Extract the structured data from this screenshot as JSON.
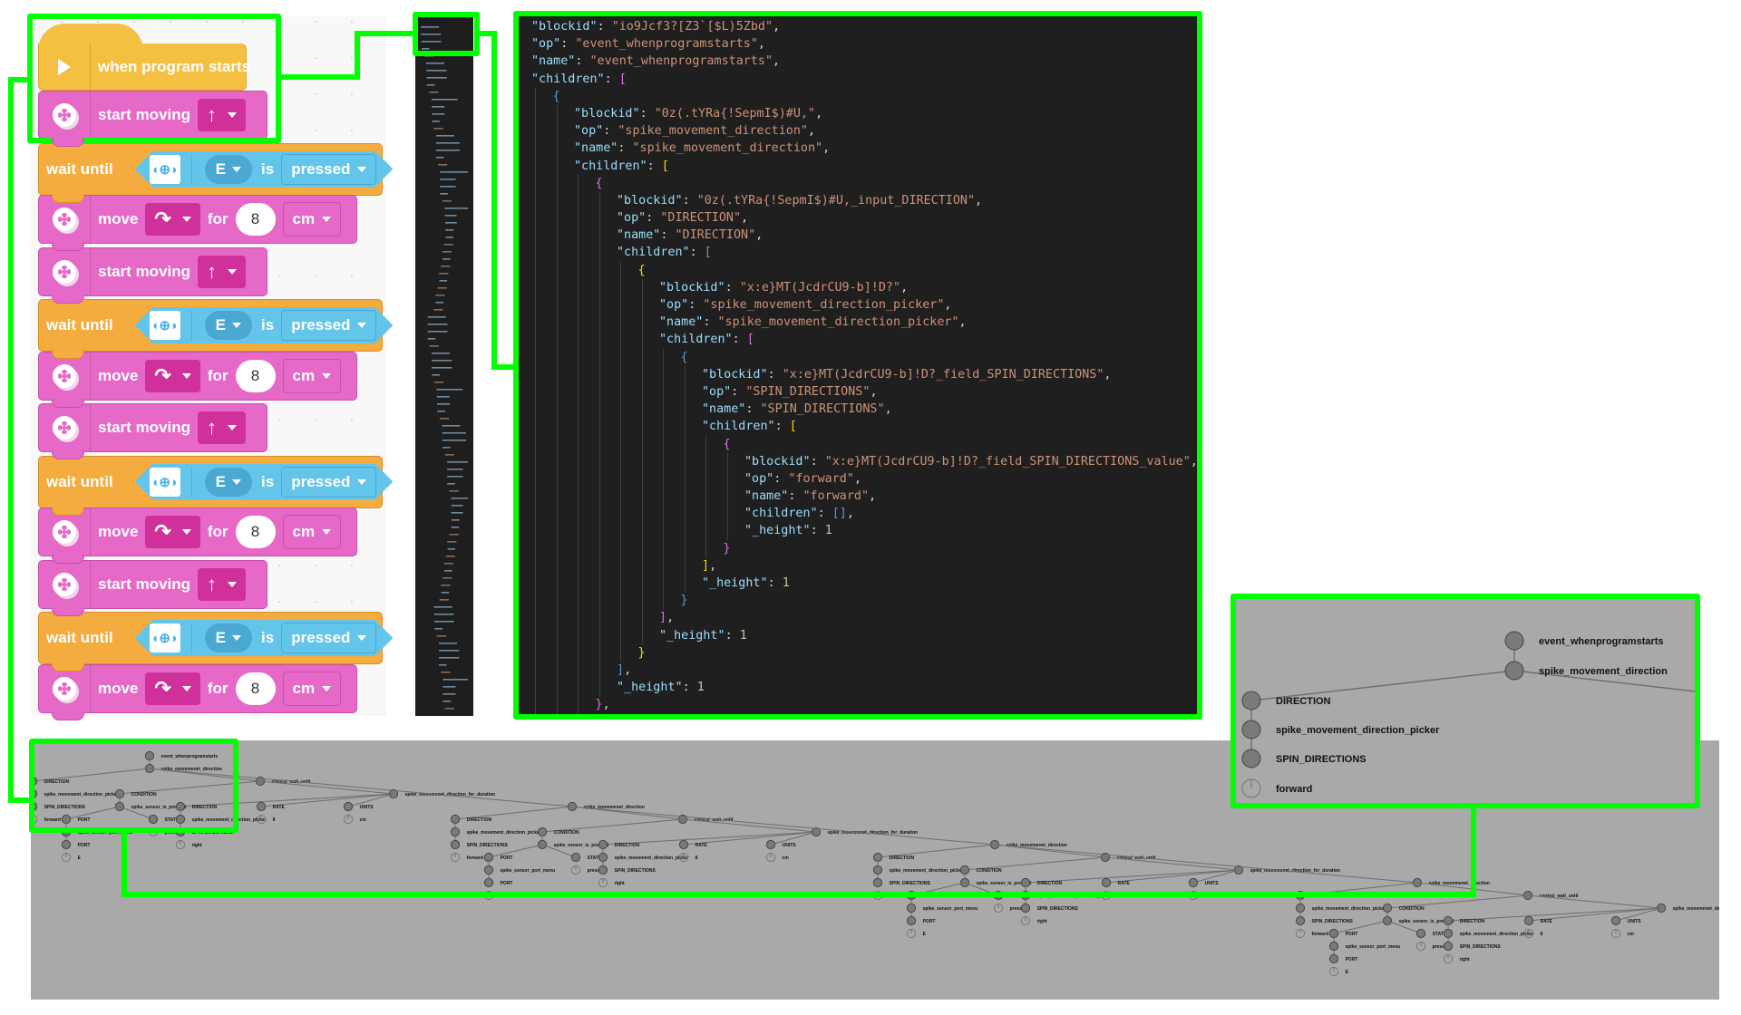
{
  "blocks_program": {
    "hat": {
      "label": "when program starts",
      "icon": "play-icon"
    },
    "blocks": [
      {
        "type": "start_moving",
        "label": "start moving",
        "direction_glyph": "↑",
        "direction": "forward"
      },
      {
        "type": "wait_until",
        "label": "wait until",
        "sensor_icon": "force-sensor-icon",
        "port": "E",
        "is_label": "is",
        "state": "pressed"
      },
      {
        "type": "move_for",
        "label": "move",
        "direction_glyph": "↷",
        "direction": "right",
        "for_label": "for",
        "amount": "8",
        "unit": "cm"
      },
      {
        "type": "start_moving",
        "label": "start moving",
        "direction_glyph": "↑",
        "direction": "forward"
      },
      {
        "type": "wait_until",
        "label": "wait until",
        "sensor_icon": "force-sensor-icon",
        "port": "E",
        "is_label": "is",
        "state": "pressed"
      },
      {
        "type": "move_for",
        "label": "move",
        "direction_glyph": "↷",
        "direction": "right",
        "for_label": "for",
        "amount": "8",
        "unit": "cm"
      },
      {
        "type": "start_moving",
        "label": "start moving",
        "direction_glyph": "↑",
        "direction": "forward"
      },
      {
        "type": "wait_until",
        "label": "wait until",
        "sensor_icon": "force-sensor-icon",
        "port": "E",
        "is_label": "is",
        "state": "pressed"
      },
      {
        "type": "move_for",
        "label": "move",
        "direction_glyph": "↷",
        "direction": "right",
        "for_label": "for",
        "amount": "8",
        "unit": "cm"
      },
      {
        "type": "start_moving",
        "label": "start moving",
        "direction_glyph": "↑",
        "direction": "forward"
      },
      {
        "type": "wait_until",
        "label": "wait until",
        "sensor_icon": "force-sensor-icon",
        "port": "E",
        "is_label": "is",
        "state": "pressed"
      },
      {
        "type": "move_for",
        "label": "move",
        "direction_glyph": "↷",
        "direction": "right",
        "for_label": "for",
        "amount": "8",
        "unit": "cm"
      }
    ]
  },
  "json_view": {
    "lines": [
      {
        "indent": 0,
        "parts": [
          [
            "k",
            "\"blockid\""
          ],
          [
            "p",
            ": "
          ],
          [
            "s",
            "\"io9Jcf3?[Z3`[$L)5Zbd\""
          ],
          [
            "p",
            ","
          ]
        ]
      },
      {
        "indent": 0,
        "parts": [
          [
            "k",
            "\"op\""
          ],
          [
            "p",
            ": "
          ],
          [
            "s",
            "\"event_whenprogramstarts\""
          ],
          [
            "p",
            ","
          ]
        ]
      },
      {
        "indent": 0,
        "parts": [
          [
            "k",
            "\"name\""
          ],
          [
            "p",
            ": "
          ],
          [
            "s",
            "\"event_whenprogramstarts\""
          ],
          [
            "p",
            ","
          ]
        ]
      },
      {
        "indent": 0,
        "parts": [
          [
            "k",
            "\"children\""
          ],
          [
            "p",
            ": "
          ],
          [
            "b1",
            "["
          ]
        ]
      },
      {
        "indent": 1,
        "parts": [
          [
            "b3",
            "{"
          ]
        ]
      },
      {
        "indent": 2,
        "parts": [
          [
            "k",
            "\"blockid\""
          ],
          [
            "p",
            ": "
          ],
          [
            "s",
            "\"0z(.tYRa{!SepmI$)#U,\""
          ],
          [
            "p",
            ","
          ]
        ]
      },
      {
        "indent": 2,
        "parts": [
          [
            "k",
            "\"op\""
          ],
          [
            "p",
            ": "
          ],
          [
            "s",
            "\"spike_movement_direction\""
          ],
          [
            "p",
            ","
          ]
        ]
      },
      {
        "indent": 2,
        "parts": [
          [
            "k",
            "\"name\""
          ],
          [
            "p",
            ": "
          ],
          [
            "s",
            "\"spike_movement_direction\""
          ],
          [
            "p",
            ","
          ]
        ]
      },
      {
        "indent": 2,
        "parts": [
          [
            "k",
            "\"children\""
          ],
          [
            "p",
            ": "
          ],
          [
            "b2",
            "["
          ]
        ]
      },
      {
        "indent": 3,
        "parts": [
          [
            "b1",
            "{"
          ]
        ]
      },
      {
        "indent": 4,
        "parts": [
          [
            "k",
            "\"blockid\""
          ],
          [
            "p",
            ": "
          ],
          [
            "s",
            "\"0z(.tYRa{!SepmI$)#U,_input_DIRECTION\""
          ],
          [
            "p",
            ","
          ]
        ]
      },
      {
        "indent": 4,
        "parts": [
          [
            "k",
            "\"op\""
          ],
          [
            "p",
            ": "
          ],
          [
            "s",
            "\"DIRECTION\""
          ],
          [
            "p",
            ","
          ]
        ]
      },
      {
        "indent": 4,
        "parts": [
          [
            "k",
            "\"name\""
          ],
          [
            "p",
            ": "
          ],
          [
            "s",
            "\"DIRECTION\""
          ],
          [
            "p",
            ","
          ]
        ]
      },
      {
        "indent": 4,
        "parts": [
          [
            "k",
            "\"children\""
          ],
          [
            "p",
            ": "
          ],
          [
            "b3",
            "["
          ]
        ]
      },
      {
        "indent": 5,
        "parts": [
          [
            "b2",
            "{"
          ]
        ]
      },
      {
        "indent": 6,
        "parts": [
          [
            "k",
            "\"blockid\""
          ],
          [
            "p",
            ": "
          ],
          [
            "s",
            "\"x:e}MT(JcdrCU9-b]!D?\""
          ],
          [
            "p",
            ","
          ]
        ]
      },
      {
        "indent": 6,
        "parts": [
          [
            "k",
            "\"op\""
          ],
          [
            "p",
            ": "
          ],
          [
            "s",
            "\"spike_movement_direction_picker\""
          ],
          [
            "p",
            ","
          ]
        ]
      },
      {
        "indent": 6,
        "parts": [
          [
            "k",
            "\"name\""
          ],
          [
            "p",
            ": "
          ],
          [
            "s",
            "\"spike_movement_direction_picker\""
          ],
          [
            "p",
            ","
          ]
        ]
      },
      {
        "indent": 6,
        "parts": [
          [
            "k",
            "\"children\""
          ],
          [
            "p",
            ": "
          ],
          [
            "b1",
            "["
          ]
        ]
      },
      {
        "indent": 7,
        "parts": [
          [
            "b3",
            "{"
          ]
        ]
      },
      {
        "indent": 8,
        "parts": [
          [
            "k",
            "\"blockid\""
          ],
          [
            "p",
            ": "
          ],
          [
            "s",
            "\"x:e}MT(JcdrCU9-b]!D?_field_SPIN_DIRECTIONS\""
          ],
          [
            "p",
            ","
          ]
        ]
      },
      {
        "indent": 8,
        "parts": [
          [
            "k",
            "\"op\""
          ],
          [
            "p",
            ": "
          ],
          [
            "s",
            "\"SPIN_DIRECTIONS\""
          ],
          [
            "p",
            ","
          ]
        ]
      },
      {
        "indent": 8,
        "parts": [
          [
            "k",
            "\"name\""
          ],
          [
            "p",
            ": "
          ],
          [
            "s",
            "\"SPIN_DIRECTIONS\""
          ],
          [
            "p",
            ","
          ]
        ]
      },
      {
        "indent": 8,
        "parts": [
          [
            "k",
            "\"children\""
          ],
          [
            "p",
            ": "
          ],
          [
            "b2",
            "["
          ]
        ]
      },
      {
        "indent": 9,
        "parts": [
          [
            "b1",
            "{"
          ]
        ]
      },
      {
        "indent": 10,
        "parts": [
          [
            "k",
            "\"blockid\""
          ],
          [
            "p",
            ": "
          ],
          [
            "s",
            "\"x:e}MT(JcdrCU9-b]!D?_field_SPIN_DIRECTIONS_value\""
          ],
          [
            "p",
            ","
          ]
        ]
      },
      {
        "indent": 10,
        "parts": [
          [
            "k",
            "\"op\""
          ],
          [
            "p",
            ": "
          ],
          [
            "s",
            "\"forward\""
          ],
          [
            "p",
            ","
          ]
        ]
      },
      {
        "indent": 10,
        "parts": [
          [
            "k",
            "\"name\""
          ],
          [
            "p",
            ": "
          ],
          [
            "s",
            "\"forward\""
          ],
          [
            "p",
            ","
          ]
        ]
      },
      {
        "indent": 10,
        "parts": [
          [
            "k",
            "\"children\""
          ],
          [
            "p",
            ": "
          ],
          [
            "b3",
            "[]"
          ],
          [
            "p",
            ","
          ]
        ]
      },
      {
        "indent": 10,
        "parts": [
          [
            "k",
            "\"_height\""
          ],
          [
            "p",
            ": "
          ],
          [
            "n",
            "1"
          ]
        ]
      },
      {
        "indent": 9,
        "parts": [
          [
            "b1",
            "}"
          ]
        ]
      },
      {
        "indent": 8,
        "parts": [
          [
            "b2",
            "]"
          ],
          [
            "p",
            ","
          ]
        ]
      },
      {
        "indent": 8,
        "parts": [
          [
            "k",
            "\"_height\""
          ],
          [
            "p",
            ": "
          ],
          [
            "n",
            "1"
          ]
        ]
      },
      {
        "indent": 7,
        "parts": [
          [
            "b3",
            "}"
          ]
        ]
      },
      {
        "indent": 6,
        "parts": [
          [
            "b1",
            "]"
          ],
          [
            "p",
            ","
          ]
        ]
      },
      {
        "indent": 6,
        "parts": [
          [
            "k",
            "\"_height\""
          ],
          [
            "p",
            ": "
          ],
          [
            "n",
            "1"
          ]
        ]
      },
      {
        "indent": 5,
        "parts": [
          [
            "b2",
            "}"
          ]
        ]
      },
      {
        "indent": 4,
        "parts": [
          [
            "b3",
            "]"
          ],
          [
            "p",
            ","
          ]
        ]
      },
      {
        "indent": 4,
        "parts": [
          [
            "k",
            "\"_height\""
          ],
          [
            "p",
            ": "
          ],
          [
            "n",
            "1"
          ]
        ]
      },
      {
        "indent": 3,
        "parts": [
          [
            "b1",
            "}"
          ],
          [
            "p",
            ","
          ]
        ]
      }
    ]
  },
  "tree_detail": {
    "nodes": [
      {
        "label": "event_whenprogramstarts",
        "leaf": false
      },
      {
        "label": "spike_movement_direction",
        "leaf": false
      },
      {
        "label": "DIRECTION",
        "leaf": false
      },
      {
        "label": "spike_movement_direction_picker",
        "leaf": false
      },
      {
        "label": "SPIN_DIRECTIONS",
        "leaf": false
      },
      {
        "label": "forward",
        "leaf": true
      }
    ]
  },
  "tree_full": {
    "root_label": "event_whenprogramstarts",
    "groups": [
      {
        "move_label": "spike_movemenet_direction",
        "move_dir_value": "forward",
        "wait_label": "control_wait_until",
        "condition_label": "CONDITION",
        "sensor_label": "spike_sensor_is_pressed",
        "port_label": "PORT",
        "port_menu_label": "spike_sensor_port_menu",
        "port_value": "E",
        "state_label": "STATE",
        "state_value": "pressed",
        "duration_label": "spike_movemenet_direction_for_duration",
        "duration_dir_value": "right",
        "rate_label": "RATE",
        "rate_value": "8",
        "units_label": "UNITS",
        "units_value": "cm",
        "direction_label": "DIRECTION",
        "picker_label": "spike_movement_direction_picker",
        "spin_label": "SPIN_DIRECTIONS"
      },
      {
        "move_label": "spike_movemenet_direction",
        "move_dir_value": "forward",
        "wait_label": "control_wait_until",
        "condition_label": "CONDITION",
        "sensor_label": "spike_sensor_is_pressed",
        "port_label": "PORT",
        "port_menu_label": "spike_sensor_port_menu",
        "port_value": "E",
        "state_label": "STATE",
        "state_value": "pressed",
        "duration_label": "spike_movemenet_direction_for_duration",
        "duration_dir_value": "right",
        "rate_label": "RATE",
        "rate_value": "8",
        "units_label": "UNITS",
        "units_value": "cm",
        "direction_label": "DIRECTION",
        "picker_label": "spike_movement_direction_picker",
        "spin_label": "SPIN_DIRECTIONS"
      },
      {
        "move_label": "spike_movemenet_direction",
        "move_dir_value": "forward",
        "wait_label": "control_wait_until",
        "condition_label": "CONDITION",
        "sensor_label": "spike_sensor_is_pressed",
        "port_label": "PORT",
        "port_menu_label": "spike_sensor_port_menu",
        "port_value": "E",
        "state_label": "STATE",
        "state_value": "pressed",
        "duration_label": "spike_movemenet_direction_for_duration",
        "duration_dir_value": "right",
        "rate_label": "RATE",
        "rate_value": "8",
        "units_label": "UNITS",
        "units_value": "cm",
        "direction_label": "DIRECTION",
        "picker_label": "spike_movement_direction_picker",
        "spin_label": "SPIN_DIRECTIONS"
      },
      {
        "move_label": "spike_movemenet_direction",
        "move_dir_value": "forward",
        "wait_label": "control_wait_until",
        "condition_label": "CONDITION",
        "sensor_label": "spike_sensor_is_pressed",
        "port_label": "PORT",
        "port_menu_label": "spike_sensor_port_menu",
        "port_value": "E",
        "state_label": "STATE",
        "state_value": "pressed",
        "duration_label": "spike_movemenet_direction_for_duration",
        "duration_dir_value": "right",
        "rate_label": "RATE",
        "rate_value": "8",
        "units_label": "UNITS",
        "units_value": "cm",
        "direction_label": "DIRECTION",
        "picker_label": "spike_movement_direction_picker",
        "spin_label": "SPIN_DIRECTIONS"
      }
    ]
  },
  "colors": {
    "highlight": "#00ff00",
    "motor_block": "#e669c8",
    "control_block": "#f4ac3f",
    "event_block": "#f5bf41",
    "sensor_block": "#64c5ea",
    "editor_bg": "#1f1f1f",
    "tree_bg": "#a9a9a9"
  }
}
